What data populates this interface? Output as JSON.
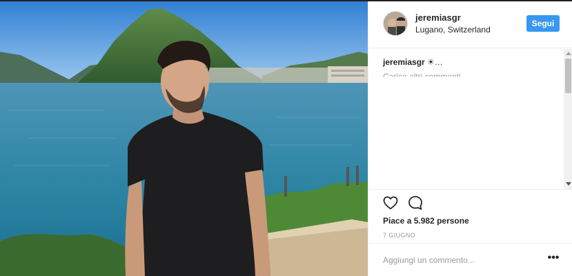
{
  "post": {
    "username": "jeremiasgr",
    "location": "Lugano, Switzerland",
    "follow_label": "Segui",
    "caption_user": "jeremiasgr",
    "caption_text": " ☀…",
    "load_more": "Carica altri commenti",
    "likes_text": "Piace a 5.982 persone",
    "date": "7 GIUGNO",
    "comment_placeholder": "Aggiungi un commento...",
    "more_label": "•••"
  },
  "icons": {
    "like": "heart-icon",
    "comment": "comment-icon",
    "more": "more-options-icon"
  },
  "colors": {
    "accent": "#3897f0",
    "text": "#262626",
    "muted": "#999999"
  }
}
